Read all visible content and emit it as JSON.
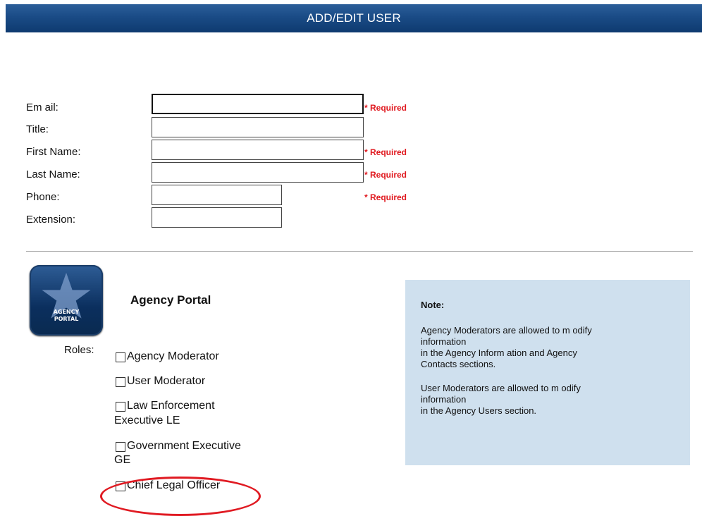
{
  "header": {
    "title": "ADD/EDIT USER"
  },
  "form": {
    "email_label": "Em ail:",
    "title_label": "Title:",
    "first_name_label": "First Name:",
    "last_name_label": "Last Name:",
    "phone_label": "Phone:",
    "extension_label": "Extension:",
    "required_text": "* Required",
    "email_value": "",
    "title_value": "",
    "first_name_value": "",
    "last_name_value": "",
    "phone_value": "",
    "extension_value": ""
  },
  "portal": {
    "icon_text_line1": "AGENCY",
    "icon_text_line2": "PORTAL",
    "title": "Agency Portal",
    "roles_label": "Roles:",
    "roles": [
      {
        "line1": "Agency Moderator",
        "line2": "",
        "checked": false
      },
      {
        "line1": "User Moderator",
        "line2": "",
        "checked": false
      },
      {
        "line1": "Law Enforcement",
        "line2": "Executive LE",
        "checked": false
      },
      {
        "line1": "Government Executive",
        "line2": "GE",
        "checked": false
      },
      {
        "line1": "Chief Legal Officer",
        "line2": "",
        "checked": false
      }
    ]
  },
  "note": {
    "title": "Note:",
    "para1_line1": "Agency Moderators are allowed to m odify",
    "para1_line2": "information",
    "para1_line3": "in the Agency Inform ation and Agency",
    "para1_line4": "Contacts sections.",
    "para2_line1": "User Moderators are allowed to m odify",
    "para2_line2": "information",
    "para2_line3": "in the Agency Users section."
  },
  "colors": {
    "header_bg": "#1a4b86",
    "required": "#e0191f",
    "note_bg": "#cfe0ee",
    "highlight_circle": "#e01a22"
  },
  "icons": {
    "portal": "agency-portal-star-icon",
    "checkbox": "checkbox-icon"
  }
}
